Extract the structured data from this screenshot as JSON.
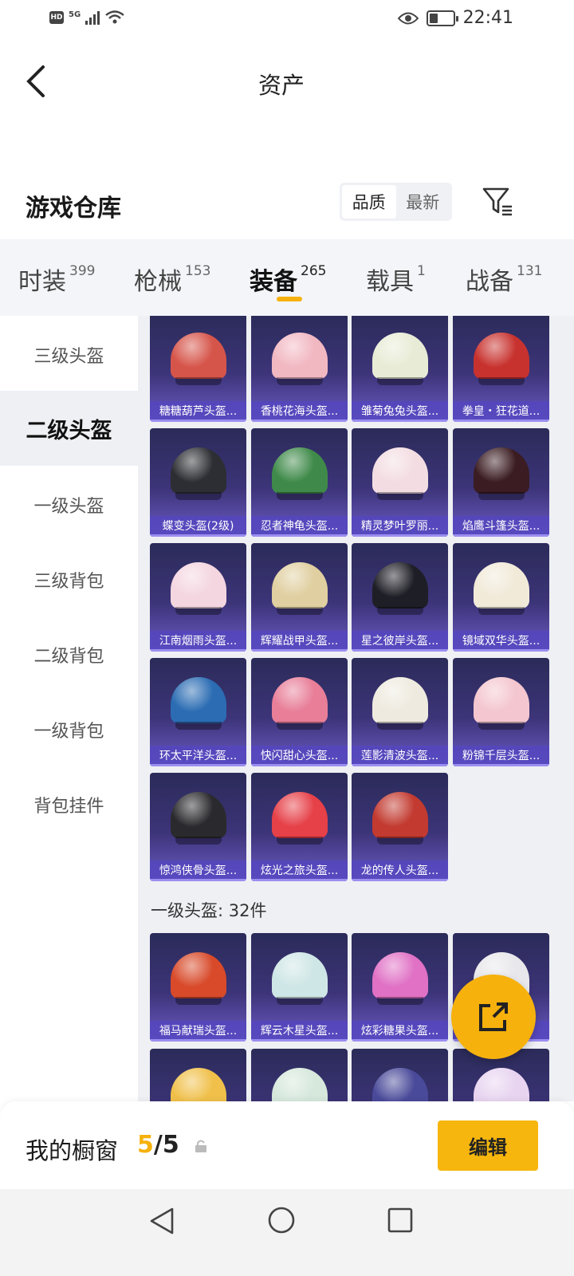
{
  "status_bar": {
    "hd": "HD",
    "network": "5G",
    "time": "22:41"
  },
  "header": {
    "title": "资产"
  },
  "warehouse": {
    "title": "游戏仓库",
    "sort_options": [
      "品质",
      "最新"
    ],
    "sort_selected": "品质"
  },
  "tabs": [
    {
      "label": "时装",
      "count": "399"
    },
    {
      "label": "枪械",
      "count": "153"
    },
    {
      "label": "装备",
      "count": "265",
      "active": true
    },
    {
      "label": "载具",
      "count": "1"
    },
    {
      "label": "战备",
      "count": "131"
    }
  ],
  "sidenav": {
    "items": [
      "三级头盔",
      "二级头盔",
      "一级头盔",
      "三级背包",
      "二级背包",
      "一级背包",
      "背包挂件"
    ],
    "active": "二级头盔"
  },
  "items_level2": [
    {
      "name": "糖糖葫芦头盔...",
      "color": "#d6554a"
    },
    {
      "name": "香桃花海头盔...",
      "color": "#f2b8c2"
    },
    {
      "name": "雏菊兔兔头盔...",
      "color": "#e8ecd6"
    },
    {
      "name": "拳皇・狂花道...",
      "color": "#c8322e"
    },
    {
      "name": "蝶变头盔(2级)",
      "color": "#2d2e33"
    },
    {
      "name": "忍者神龟头盔...",
      "color": "#3f8a4a"
    },
    {
      "name": "精灵梦叶罗丽...",
      "color": "#f3dde2"
    },
    {
      "name": "焰鹰斗篷头盔...",
      "color": "#3a1c22"
    },
    {
      "name": "江南烟雨头盔...",
      "color": "#f4d6e0"
    },
    {
      "name": "辉耀战甲头盔...",
      "color": "#e0cfa0"
    },
    {
      "name": "星之彼岸头盔...",
      "color": "#1e1e26"
    },
    {
      "name": "镜域双华头盔...",
      "color": "#f1ead9"
    },
    {
      "name": "环太平洋头盔...",
      "color": "#2b6cb3"
    },
    {
      "name": "快闪甜心头盔...",
      "color": "#e87e98"
    },
    {
      "name": "莲影清波头盔...",
      "color": "#eeeadf"
    },
    {
      "name": "粉锦千层头盔...",
      "color": "#f4c6cf"
    },
    {
      "name": "惊鸿侠骨头盔...",
      "color": "#2a2a2e"
    },
    {
      "name": "炫光之旅头盔...",
      "color": "#e64048"
    },
    {
      "name": "龙的传人头盔...",
      "color": "#c23a30"
    }
  ],
  "section_level1": {
    "title": "一级头盔: 32件"
  },
  "items_level1": [
    {
      "name": "福马献瑞头盔...",
      "color": "#d84a2a"
    },
    {
      "name": "辉云木星头盔...",
      "color": "#cfe6e6"
    },
    {
      "name": "炫彩糖果头盔...",
      "color": "#e071c5"
    },
    {
      "name": "...",
      "color": "#e8e8ec"
    },
    {
      "name": "",
      "color": "#f0c04a"
    },
    {
      "name": "",
      "color": "#d6e8dc"
    },
    {
      "name": "",
      "color": "#4a4a9a"
    },
    {
      "name": "",
      "color": "#e8d4f0"
    }
  ],
  "bottom_bar": {
    "label": "我的橱窗",
    "current": "5",
    "total": "/5",
    "edit_label": "编辑"
  },
  "colors": {
    "accent": "#f6b10d",
    "card_bg": "#3c3478"
  }
}
